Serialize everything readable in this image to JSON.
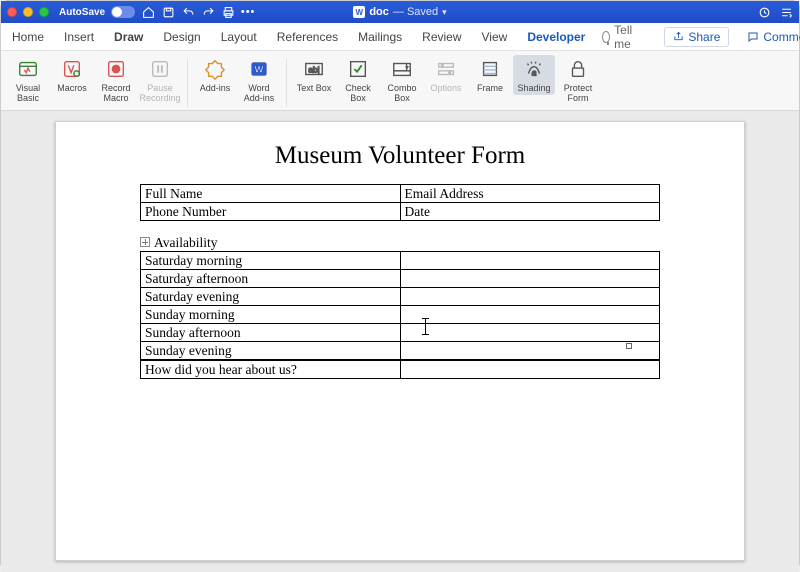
{
  "titlebar": {
    "autosave_label": "AutoSave",
    "doc_name": "doc",
    "saved_label": "— Saved"
  },
  "menu": {
    "tabs": {
      "home": "Home",
      "insert": "Insert",
      "draw": "Draw",
      "design": "Design",
      "layout": "Layout",
      "references": "References",
      "mailings": "Mailings",
      "review": "Review",
      "view": "View",
      "developer": "Developer"
    },
    "tellme": "Tell me",
    "share": "Share",
    "comments": "Comments"
  },
  "ribbon": {
    "visual_basic": "Visual Basic",
    "macros": "Macros",
    "record_macro": "Record Macro",
    "pause_recording": "Pause Recording",
    "addins": "Add-ins",
    "word_addins": "Word Add-ins",
    "text_box": "Text Box",
    "check_box": "Check Box",
    "combo_box": "Combo Box",
    "options": "Options",
    "frame": "Frame",
    "shading": "Shading",
    "protect_form": "Protect Form"
  },
  "form": {
    "title": "Museum Volunteer Form",
    "full_name": "Full Name",
    "email": "Email Address",
    "phone": "Phone Number",
    "date": "Date",
    "availability_label": "Availability",
    "slots": {
      "sat_morning": "Saturday morning",
      "sat_afternoon": "Saturday afternoon",
      "sat_evening": "Saturday evening",
      "sun_morning": "Sunday morning",
      "sun_afternoon": "Sunday afternoon",
      "sun_evening": "Sunday evening"
    },
    "hear_about_us": "How did you hear about us?"
  }
}
